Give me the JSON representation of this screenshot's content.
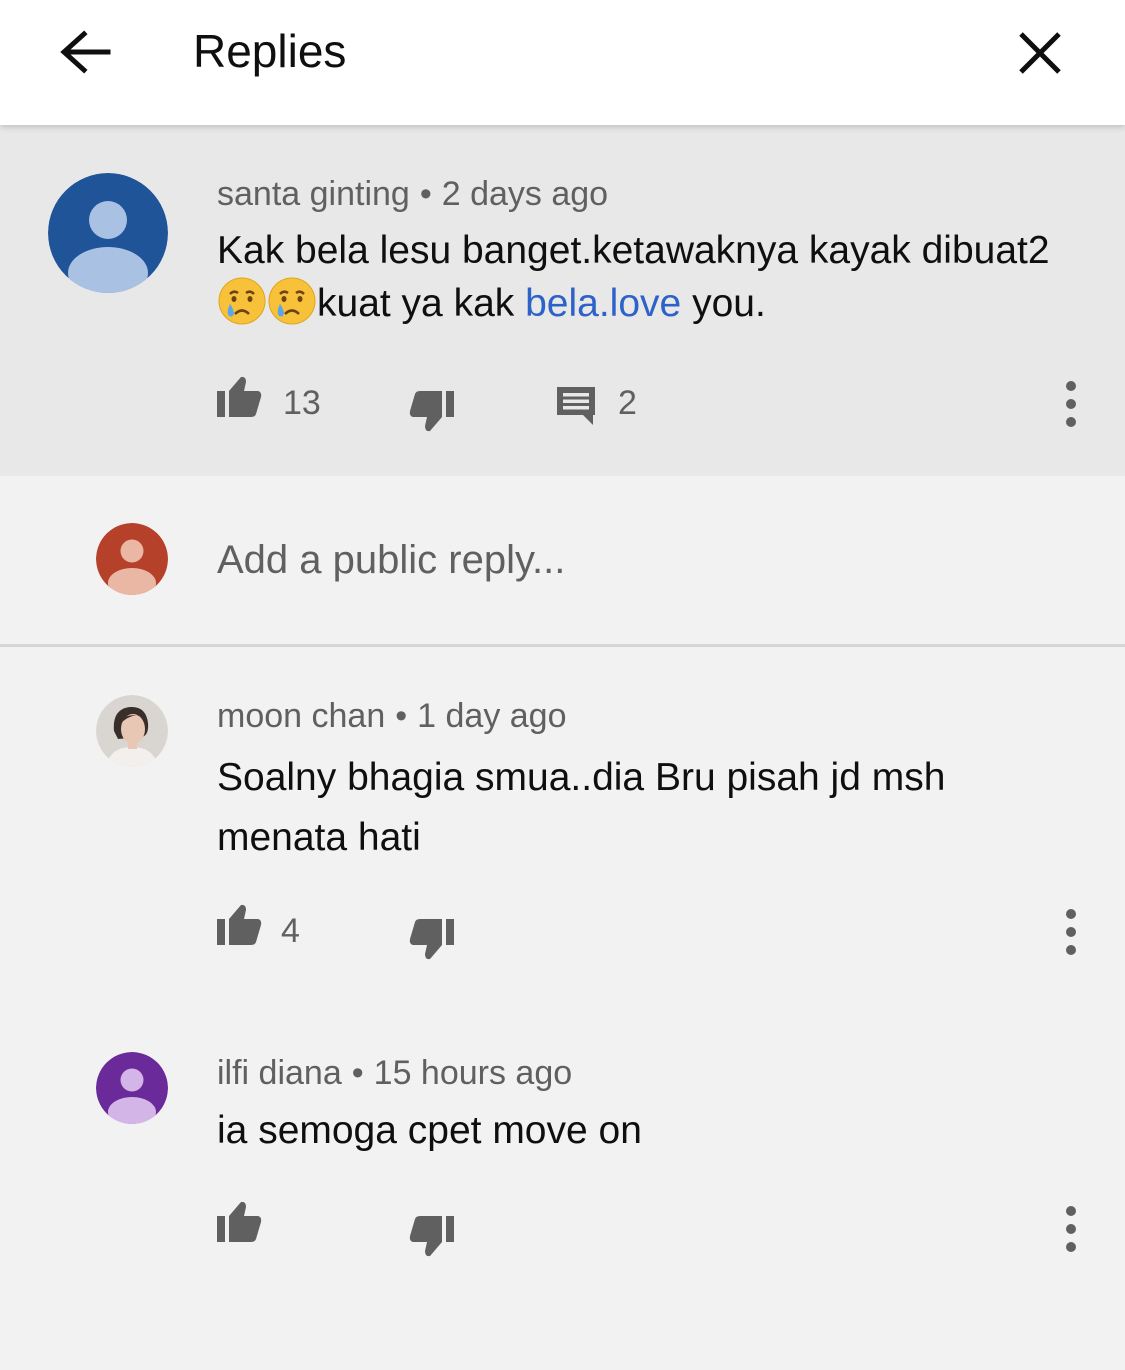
{
  "header": {
    "title": "Replies",
    "back_icon": "arrow-back-icon",
    "close_icon": "close-icon"
  },
  "parent_comment": {
    "author": "santa ginting",
    "separator": "•",
    "time": "2 days ago",
    "text_part1": "Kak bela lesu banget.ketawaknya kayak dibuat2",
    "emoji": [
      "crying-face-emoji",
      "crying-face-emoji"
    ],
    "text_part2": "kuat ya kak ",
    "link_text": "bela.love",
    "text_part3": " you.",
    "likes": "13",
    "replies": "2",
    "avatar_color": "#1f5499"
  },
  "reply_box": {
    "placeholder": "Add a public reply...",
    "avatar_color": "#b5412a"
  },
  "replies": [
    {
      "author": "moon chan",
      "separator": "•",
      "time": "1 day ago",
      "text": "Soalny bhagia smua..dia Bru pisah jd msh menata hati",
      "likes": "4"
    },
    {
      "author": "ilfi diana",
      "separator": "•",
      "time": "15 hours ago",
      "text": "ia semoga cpet move on",
      "likes": "",
      "avatar_color": "#6a2a9a"
    }
  ],
  "colors": {
    "background": "#f2f2f2",
    "parent_background": "#e8e8e8",
    "link": "#2d62c9",
    "icon": "#606060"
  }
}
